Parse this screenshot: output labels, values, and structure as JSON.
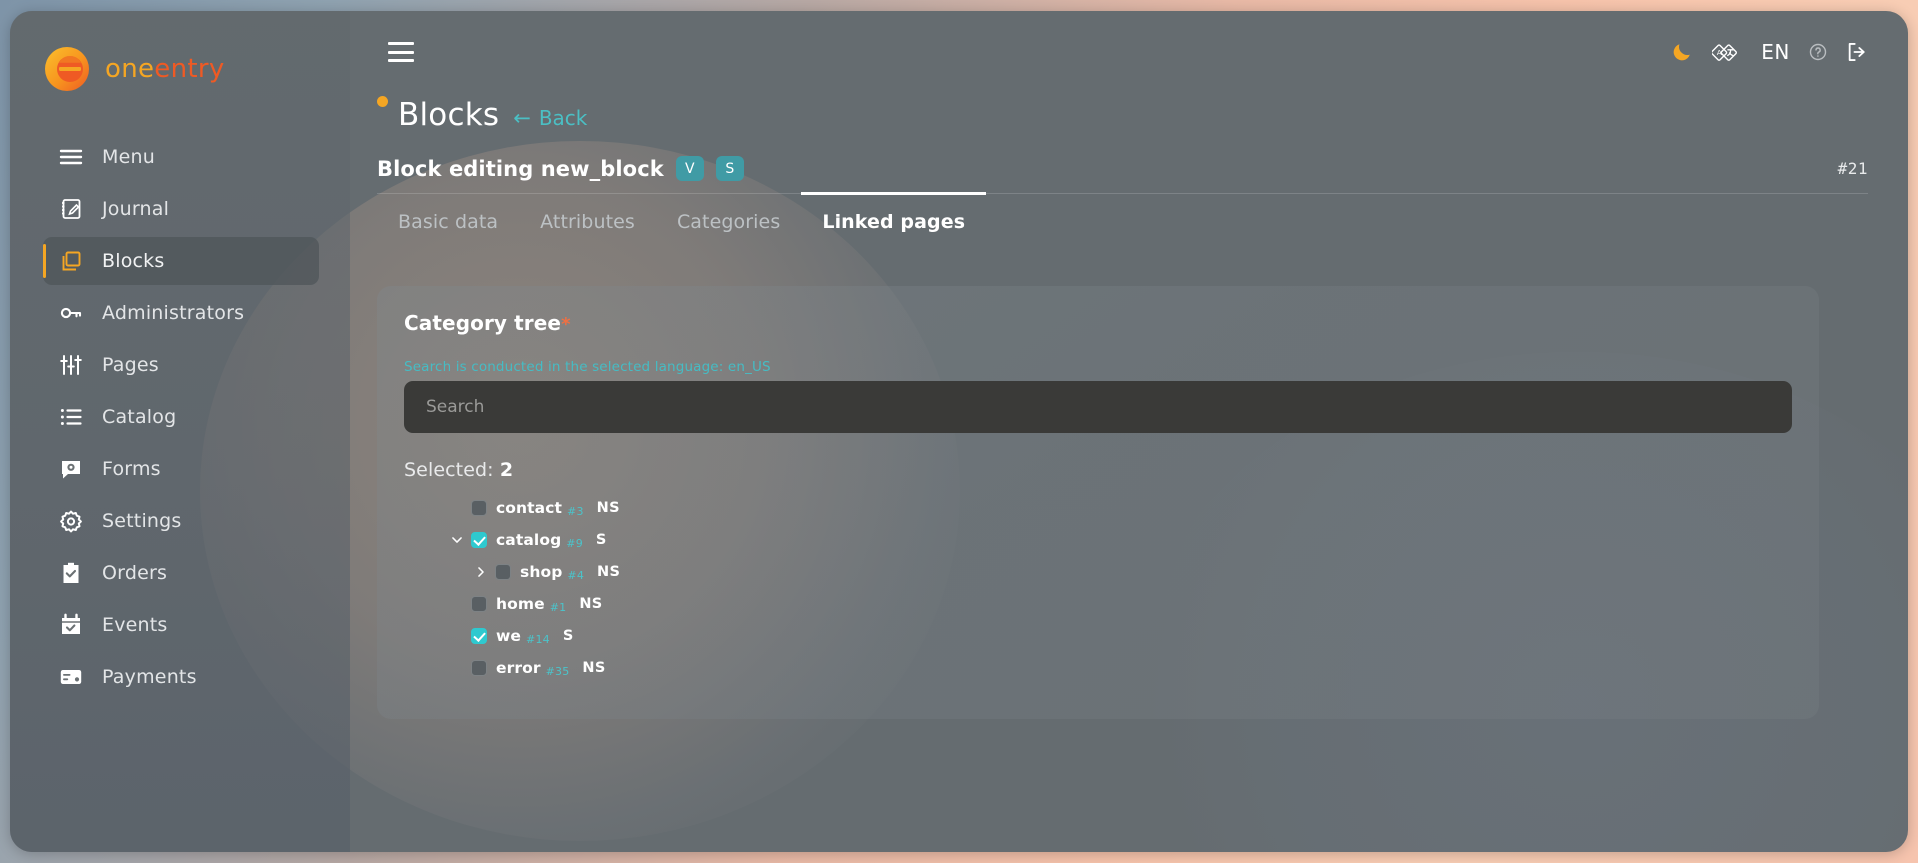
{
  "brand": {
    "name_part1": "one",
    "name_part2": "entry",
    "logo_icon": "oneentry-logo-icon"
  },
  "sidebar": {
    "items": [
      {
        "label": "Menu",
        "icon": "menu-icon",
        "active": false
      },
      {
        "label": "Journal",
        "icon": "journal-icon",
        "active": false
      },
      {
        "label": "Blocks",
        "icon": "blocks-icon",
        "active": true
      },
      {
        "label": "Administrators",
        "icon": "key-icon",
        "active": false
      },
      {
        "label": "Pages",
        "icon": "sliders-icon",
        "active": false
      },
      {
        "label": "Catalog",
        "icon": "list-icon",
        "active": false
      },
      {
        "label": "Forms",
        "icon": "form-chat-icon",
        "active": false
      },
      {
        "label": "Settings",
        "icon": "gear-icon",
        "active": false
      },
      {
        "label": "Orders",
        "icon": "clipboard-check-icon",
        "active": false
      },
      {
        "label": "Events",
        "icon": "calendar-check-icon",
        "active": false
      },
      {
        "label": "Payments",
        "icon": "credit-card-icon",
        "active": false
      }
    ]
  },
  "topbar": {
    "hamburger_icon": "hamburger-icon",
    "theme_toggle_icon": "moon-icon",
    "translate_icon": "translate-icon",
    "language": "EN",
    "help_icon": "help-circle-icon",
    "logout_icon": "logout-icon"
  },
  "page": {
    "title": "Blocks",
    "back_label": "Back",
    "back_arrow": "←",
    "status_dot_color": "#f5a623"
  },
  "editor": {
    "heading": "Block editing new_block",
    "badges": [
      "V",
      "S"
    ],
    "record_id": "#21",
    "tabs": [
      {
        "label": "Basic data",
        "active": false
      },
      {
        "label": "Attributes",
        "active": false
      },
      {
        "label": "Categories",
        "active": false
      },
      {
        "label": "Linked pages",
        "active": true
      }
    ]
  },
  "card": {
    "title": "Category tree",
    "required_marker": "*",
    "hint": "Search is conducted in the selected language: en_US",
    "search": {
      "value": "",
      "placeholder": "Search"
    },
    "selected_label": "Selected:",
    "selected_count": "2",
    "tree": [
      {
        "name": "contact",
        "id": "#3",
        "status": "NS",
        "checked": false,
        "depth": 0,
        "caret": "none"
      },
      {
        "name": "catalog",
        "id": "#9",
        "status": "S",
        "checked": true,
        "depth": 0,
        "caret": "down"
      },
      {
        "name": "shop",
        "id": "#4",
        "status": "NS",
        "checked": false,
        "depth": 1,
        "caret": "right"
      },
      {
        "name": "home",
        "id": "#1",
        "status": "NS",
        "checked": false,
        "depth": 0,
        "caret": "none"
      },
      {
        "name": "we",
        "id": "#14",
        "status": "S",
        "checked": true,
        "depth": 0,
        "caret": "none"
      },
      {
        "name": "error",
        "id": "#35",
        "status": "NS",
        "checked": false,
        "depth": 0,
        "caret": "none"
      }
    ]
  },
  "colors": {
    "accent_orange": "#f5a623",
    "accent_red": "#ef5a24",
    "teal": "#46bcc4",
    "badge_teal": "#409ba5",
    "checkbox_teal": "#2ec9cf"
  }
}
